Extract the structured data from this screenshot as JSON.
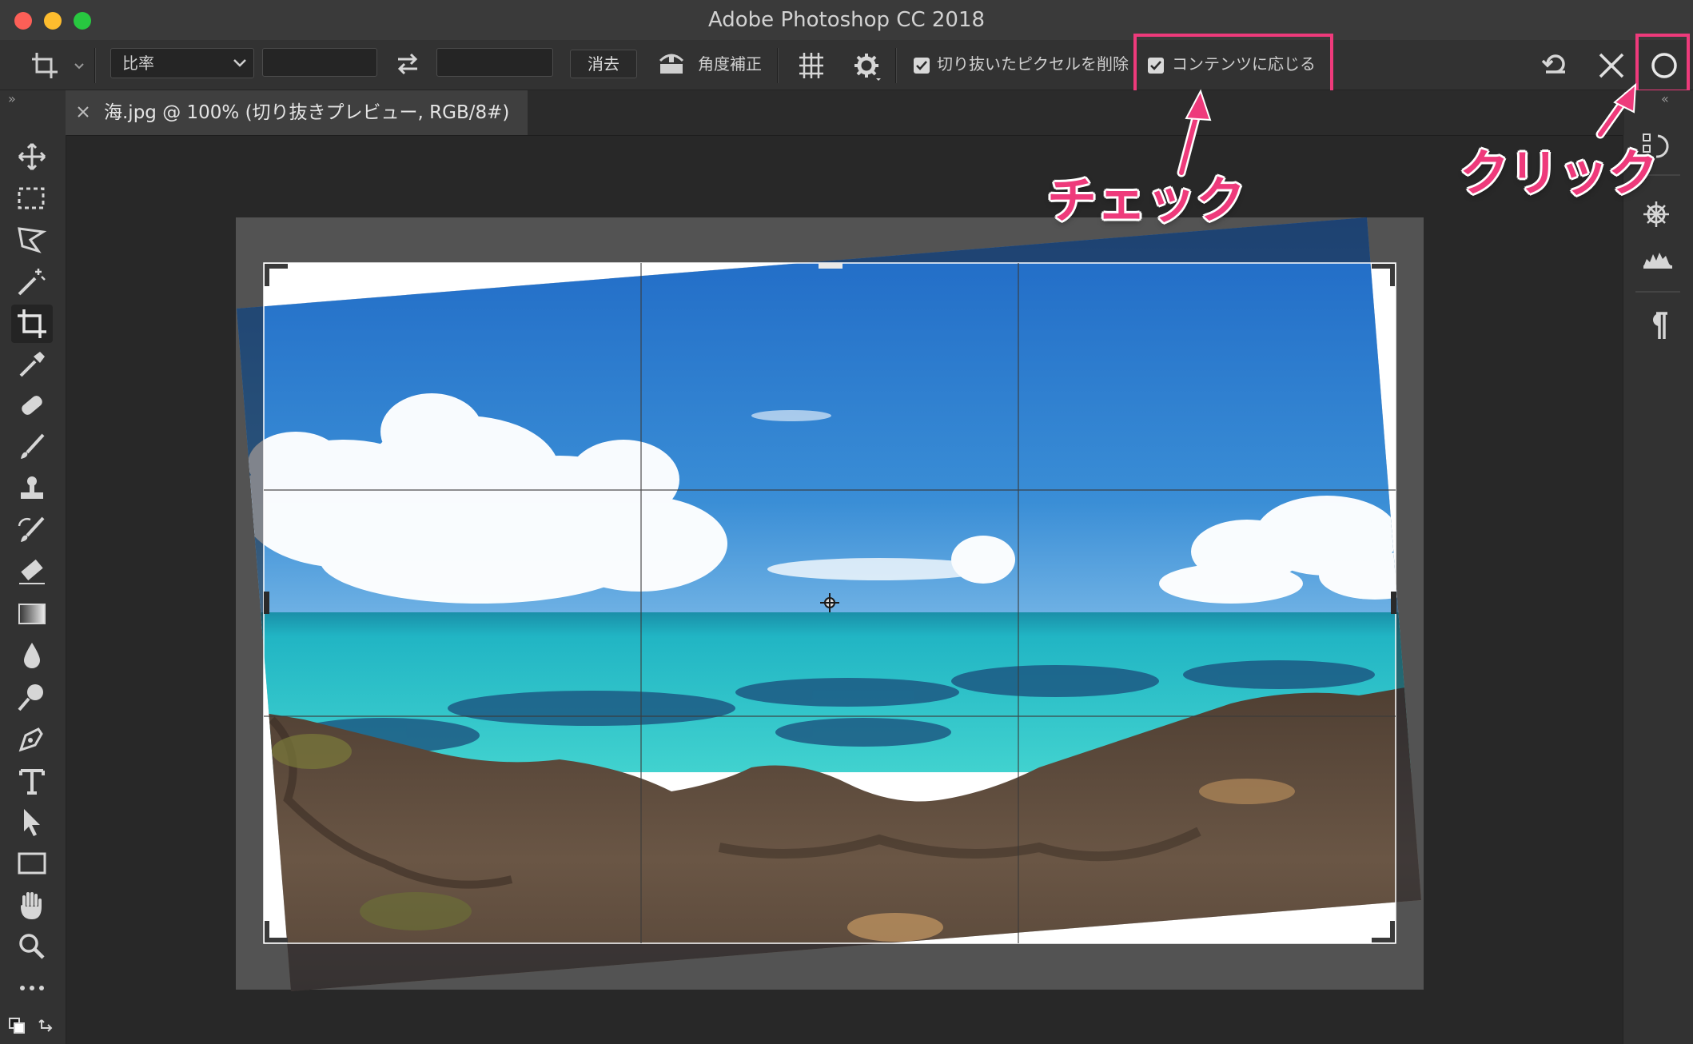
{
  "window": {
    "title": "Adobe Photoshop CC 2018"
  },
  "options_bar": {
    "ratio_select": "比率",
    "clear_button": "消去",
    "straighten_label": "角度補正",
    "delete_cropped_pixels_label": "切り抜いたピクセルを削除",
    "delete_cropped_pixels_checked": true,
    "content_aware_label": "コンテンツに応じる",
    "content_aware_checked": true
  },
  "document_tab": {
    "label": "海.jpg @ 100% (切り抜きプレビュー, RGB/8#)"
  },
  "annotations": {
    "check_label": "チェック",
    "click_label": "クリック",
    "color": "#ee3a7b"
  },
  "tools": [
    "move-icon",
    "marquee-icon",
    "lasso-icon",
    "magic-wand-icon",
    "crop-icon",
    "eyedropper-icon",
    "healing-brush-icon",
    "brush-icon",
    "clone-stamp-icon",
    "history-brush-icon",
    "eraser-icon",
    "gradient-icon",
    "blur-icon",
    "dodge-icon",
    "pen-icon",
    "type-icon",
    "path-selection-icon",
    "rectangle-icon",
    "hand-icon",
    "zoom-icon",
    "more-tools-icon"
  ],
  "colors": {
    "ui_bg": "#323232",
    "canvas_bg": "#282828",
    "sky": "#2a7fd0",
    "sea": "#24b6bf"
  }
}
